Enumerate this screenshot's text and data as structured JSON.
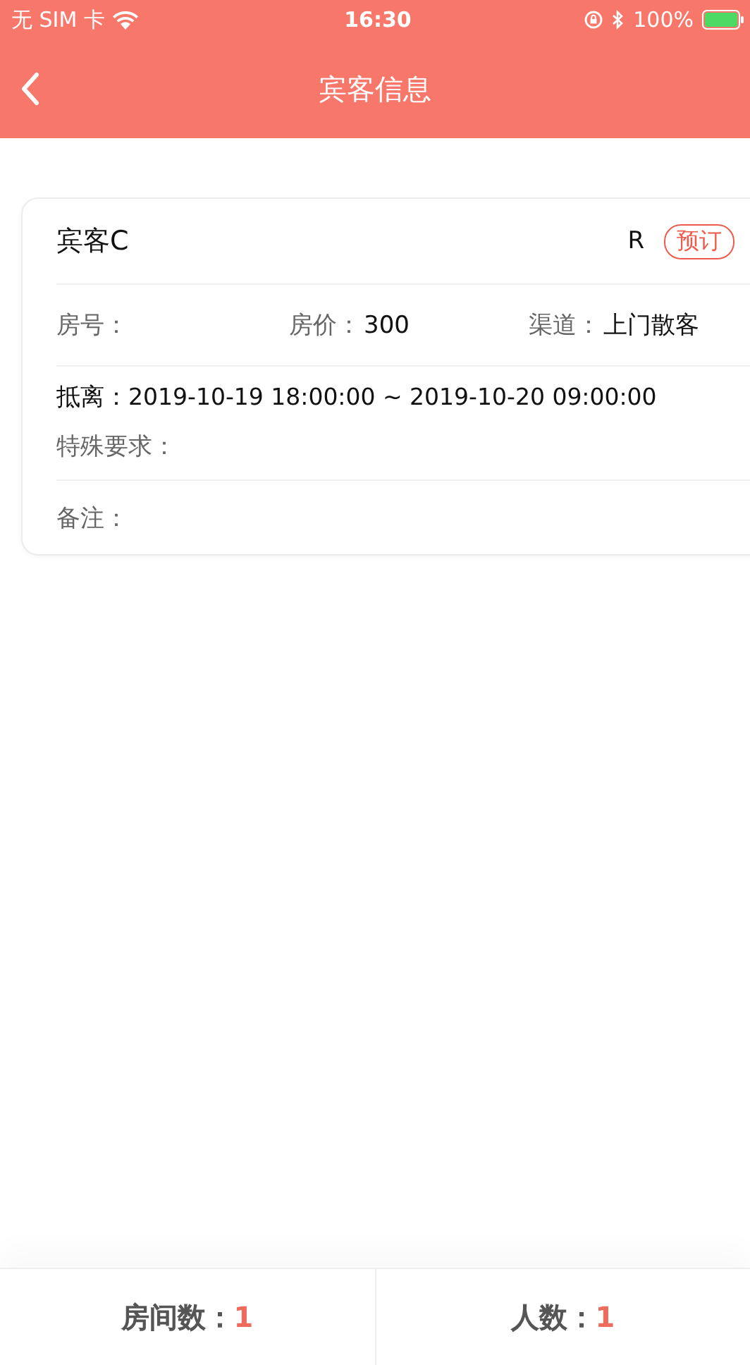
{
  "status_bar": {
    "carrier": "无 SIM 卡",
    "time": "16:30",
    "battery": "100%"
  },
  "nav": {
    "title": "宾客信息"
  },
  "guest": {
    "name": "宾客C",
    "code": "R",
    "tag": "预订",
    "fields": [
      {
        "label": "房号："
      },
      {
        "label": "房价：",
        "value": "300"
      },
      {
        "label": "渠道：",
        "value": "上门散客"
      }
    ],
    "stay": {
      "label": "抵离：",
      "value": "2019-10-19 18:00:00 ~ 2019-10-20 09:00:00"
    },
    "special": {
      "label": "特殊要求："
    },
    "note": {
      "label": "备注："
    }
  },
  "footer": [
    {
      "label": "房间数：",
      "value": "1"
    },
    {
      "label": "人数：",
      "value": "1"
    }
  ]
}
